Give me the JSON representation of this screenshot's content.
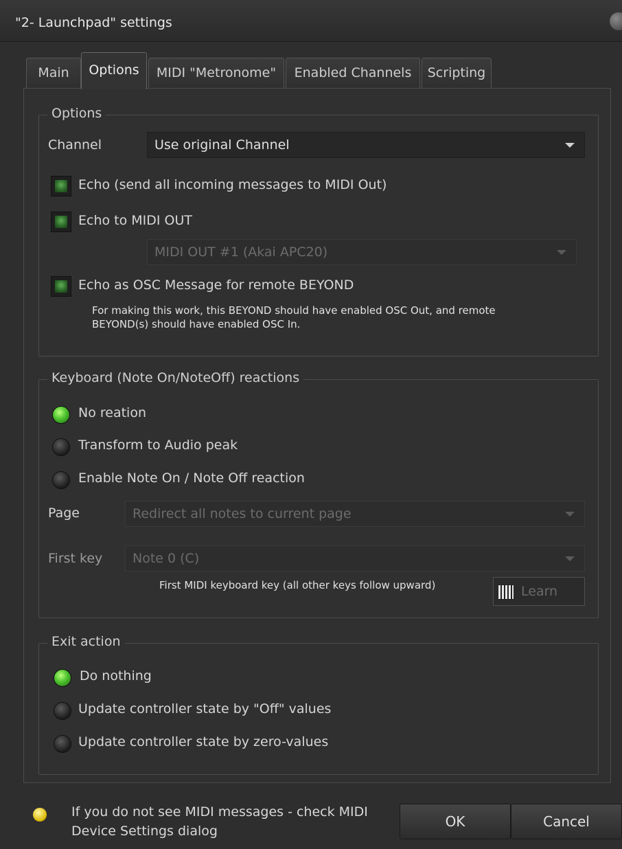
{
  "window": {
    "title": "\"2- Launchpad\" settings"
  },
  "tabs": [
    {
      "label": "Main"
    },
    {
      "label": "Options"
    },
    {
      "label": "MIDI \"Metronome\""
    },
    {
      "label": "Enabled Channels"
    },
    {
      "label": "Scripting"
    }
  ],
  "options_group": {
    "legend": "Options",
    "channel_label": "Channel",
    "channel_value": "Use original Channel",
    "echo_label": "Echo (send all incoming messages to MIDI Out)",
    "echo_checked": true,
    "echo_midi_out_label": "Echo to MIDI OUT",
    "echo_midi_out_checked": true,
    "midi_out_device_value": "MIDI OUT #1 (Akai APC20)",
    "echo_osc_label": "Echo as OSC Message for remote BEYOND",
    "echo_osc_checked": true,
    "osc_note_line1": "For making this work, this BEYOND should have enabled OSC Out, and remote",
    "osc_note_line2": "BEYOND(s) should have enabled OSC In."
  },
  "keyboard_group": {
    "legend": "Keyboard (Note On/NoteOff) reactions",
    "radio_no_reaction": "No reation",
    "radio_audio_peak": "Transform to Audio peak",
    "radio_note_reaction": "Enable Note On / Note Off reaction",
    "selected": "No reation",
    "page_label": "Page",
    "page_value": "Redirect all notes to current page",
    "first_key_label": "First key",
    "first_key_value": "Note 0 (C)",
    "first_key_note": "First MIDI keyboard key (all other keys follow upward)",
    "learn_label": "Learn"
  },
  "exit_group": {
    "legend": "Exit action",
    "radio_do_nothing": "Do nothing",
    "radio_off_values": "Update controller state by \"Off\" values",
    "radio_zero_values": "Update controller state by zero-values",
    "selected": "Do nothing"
  },
  "footer": {
    "hint_line1": "If you do not see MIDI messages - check MIDI",
    "hint_line2": "Device Settings dialog",
    "ok_label": "OK",
    "cancel_label": "Cancel"
  },
  "colors": {
    "background": "#2e2e2e",
    "led_green": "#4ec32f",
    "text": "#d6d6d6"
  }
}
